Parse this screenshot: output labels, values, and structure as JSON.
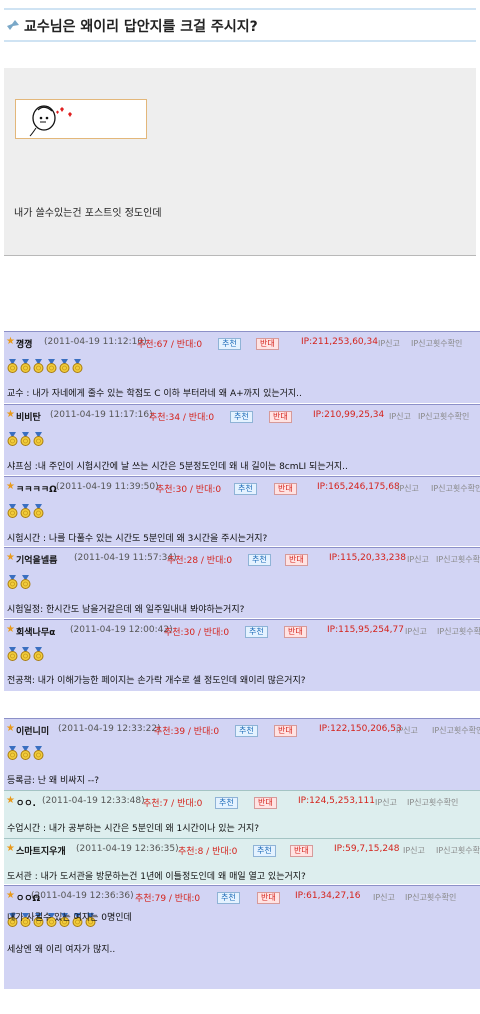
{
  "post": {
    "title": "교수님은 왜이리 답안지를 크걸 주시지?",
    "body_text": "내가 쓸수있는건 포스트잇 정도인데"
  },
  "comments": [
    {
      "nick": "꼉꼉",
      "date": "(2011-04-19 11:12:10)",
      "rec": "추천:67 / 반대:0",
      "up": "추천",
      "down": "반대",
      "ip": "IP:211,253,60,34",
      "report": "IP신고",
      "check": "IP신고횟수확인",
      "medals": 6,
      "text": [
        "교수 : 내가 자네에게 줄수 있는 학점도 C 이하 부터라네 왜 A+까지 있는거지.."
      ]
    },
    {
      "nick": "비비탄",
      "date": "(2011-04-19 11:17:16)",
      "rec": "추천:34 / 반대:0",
      "up": "추천",
      "down": "반대",
      "ip": "IP:210,99,25,34",
      "report": "IP신고",
      "check": "IP신고횟수확인",
      "medals": 3,
      "text": [
        "샤프심 :내 주인이 시험시간에 날 쓰는 시간은 5분정도인데 왜 내 길이는 8cmLI 되는거지.."
      ]
    },
    {
      "nick": "ㅋㅋㅋㅋΩ",
      "date": "(2011-04-19 11:39:50)",
      "rec": "추천:30 / 반대:0",
      "up": "추천",
      "down": "반대",
      "ip": "IP:165,246,175,68",
      "report": "IP신고",
      "check": "IP신고횟수확인",
      "medals": 3,
      "text": [
        "시험시간 : 나를 다풀수 있는 시간도 5분인데 왜 3시간을 주시는거지?"
      ]
    },
    {
      "nick": "기억을넬름",
      "date": "(2011-04-19 11:57:34)",
      "rec": "추천:28 / 반대:0",
      "up": "추천",
      "down": "반대",
      "ip": "IP:115,20,33,238",
      "report": "IP신고",
      "check": "IP신고횟수확인",
      "medals": 2,
      "text": [
        "시험일정: 한시간도 남을거같은데 왜 일주일내내 봐야하는거지?"
      ]
    },
    {
      "nick": "회색나무α",
      "date": "(2011-04-19 12:00:42)",
      "rec": "추천:30 / 반대:0",
      "up": "추천",
      "down": "반대",
      "ip": "IP:115,95,254,77",
      "report": "IP신고",
      "check": "IP신고횟수확인",
      "medals": 3,
      "text": [
        "전공책: 내가 이해가능한 페이지는 손가락 개수로 셀 정도인데 왜이리 많은거지?"
      ]
    },
    {
      "nick": "이런니미",
      "date": "(2011-04-19 12:33:22)",
      "rec": "추천:39 / 반대:0",
      "up": "추천",
      "down": "반대",
      "ip": "IP:122,150,206,53",
      "report": "IP신고",
      "check": "IP신고횟수확인",
      "medals": 3,
      "text": [
        "등록금: 난 왜 비싸지 --?"
      ]
    },
    {
      "nick": "ㅇㅇ.",
      "date": "(2011-04-19 12:33:48)",
      "rec": "추천:7 / 반대:0",
      "up": "추천",
      "down": "반대",
      "ip": "IP:124,5,253,111",
      "report": "IP신고",
      "check": "IP신고횟수확인",
      "medals": 0,
      "text": [
        "수업시간 : 내가 공부하는 시간은 5분인데 왜 1시간이나 있는 거지?"
      ]
    },
    {
      "nick": "스마트지우개",
      "date": "(2011-04-19 12:36:35)",
      "rec": "추천:8 / 반대:0",
      "up": "추천",
      "down": "반대",
      "ip": "IP:59,7,15,248",
      "report": "IP신고",
      "check": "IP신고횟수확인",
      "medals": 0,
      "text": [
        "도서관 : 내가 도서관을 방문하는건 1년에 이틀정도인데 왜 매일 열고 있는거지?"
      ]
    },
    {
      "nick": "ㅇㅇΩ",
      "date": "(2011-04-19 12:36:36)",
      "rec": "추천:79 / 반대:0",
      "up": "추천",
      "down": "반대",
      "ip": "IP:61,34,27,16",
      "report": "IP신고",
      "check": "IP신고횟수확인",
      "medals": 7,
      "text": [
        "내가 사귈수 있는 여자는 0명인데",
        "세상엔 왜 이리 여자가 많지.."
      ]
    }
  ]
}
